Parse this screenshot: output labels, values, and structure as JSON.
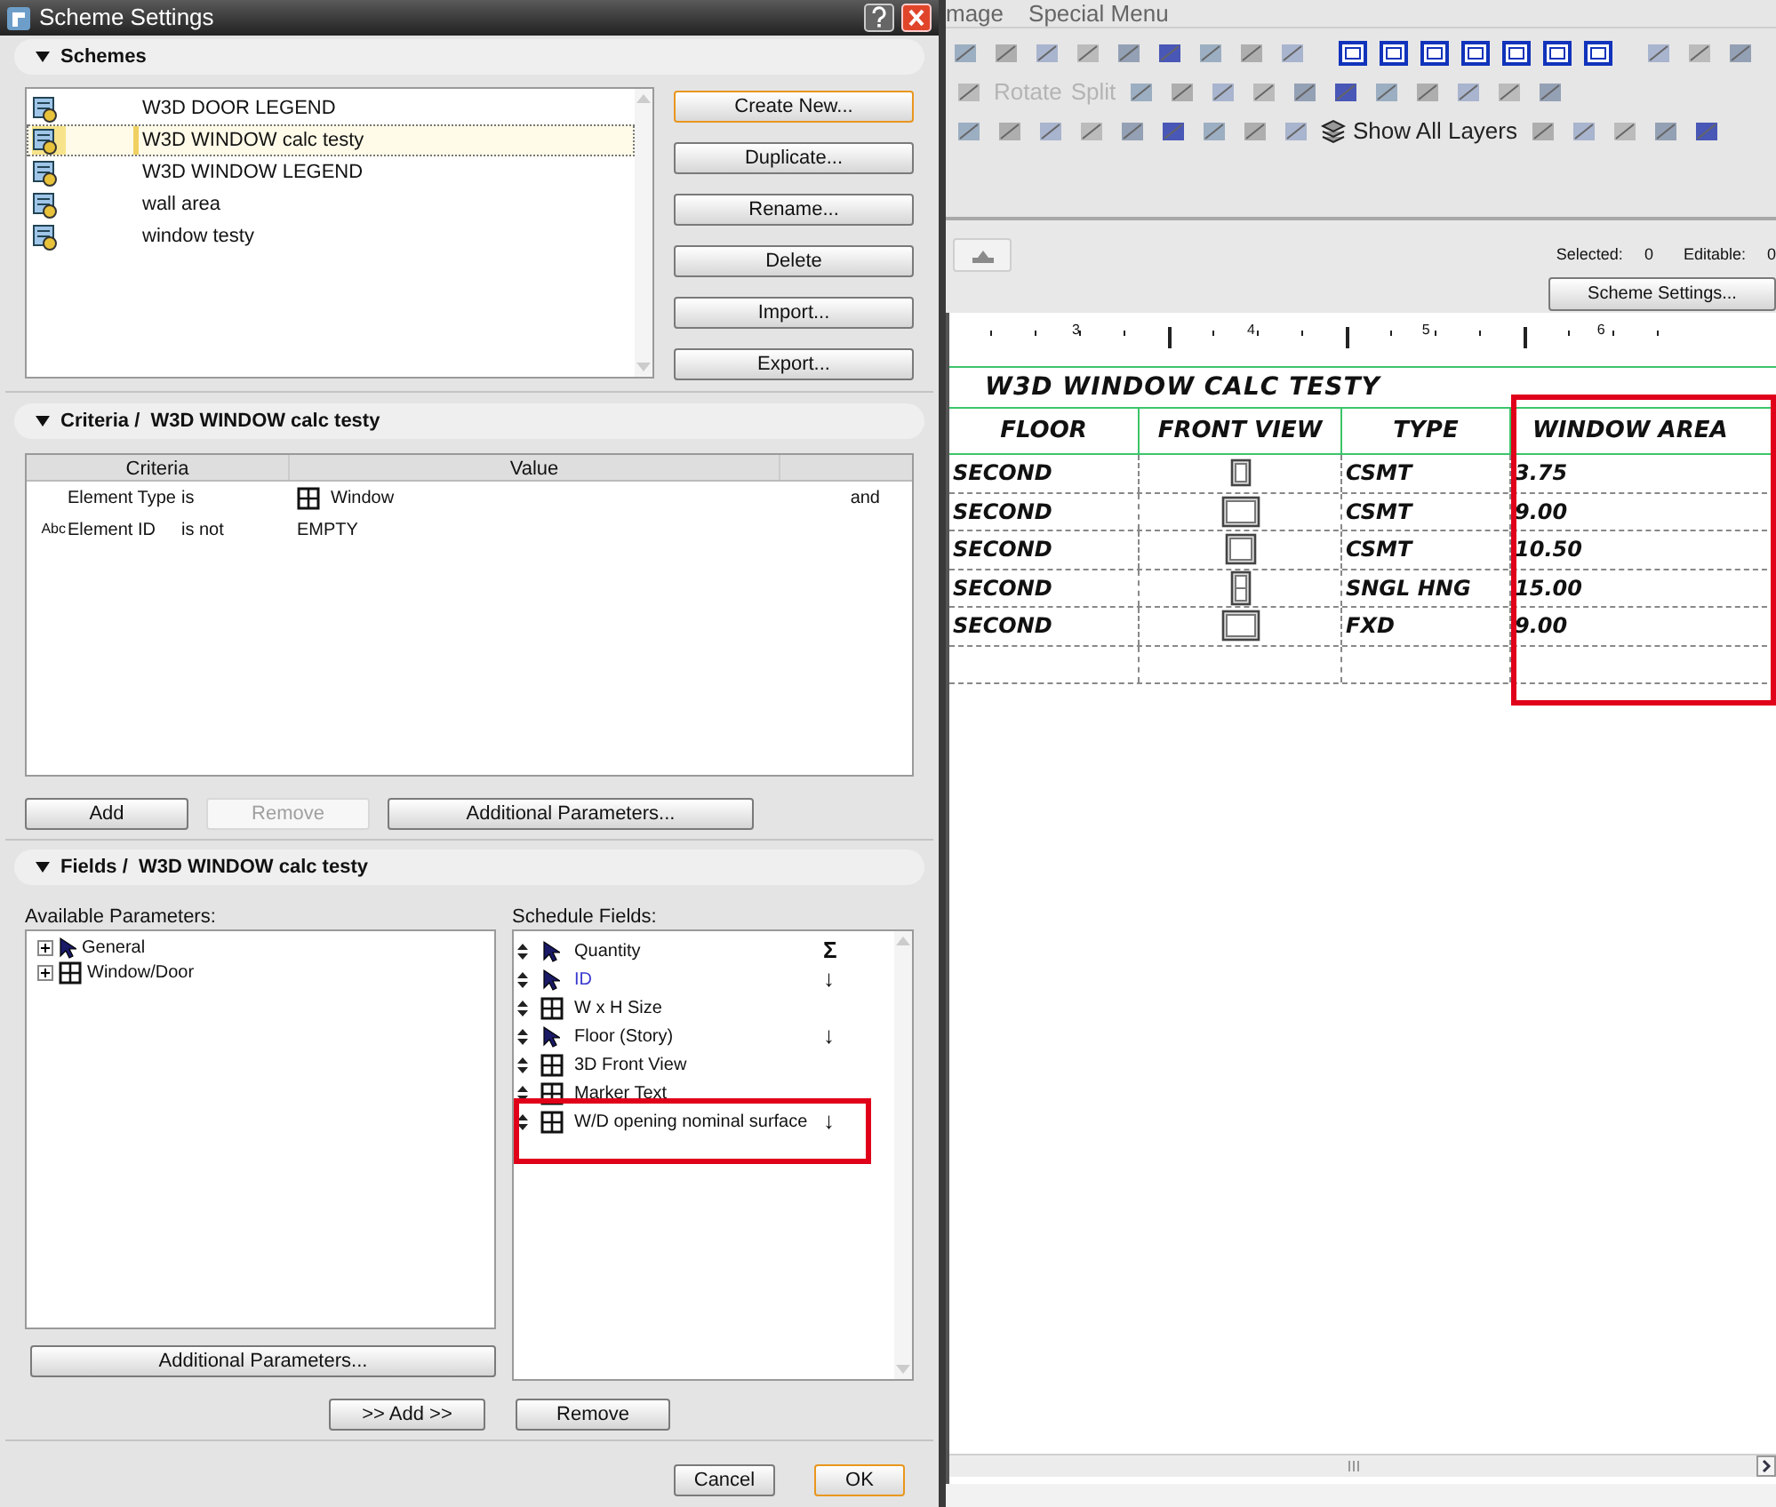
{
  "dialog": {
    "title": "Scheme Settings",
    "schemes": {
      "header": "Schemes",
      "items": [
        {
          "name": "W3D DOOR LEGEND",
          "selected": false
        },
        {
          "name": "W3D WINDOW calc testy",
          "selected": true
        },
        {
          "name": "W3D WINDOW LEGEND",
          "selected": false
        },
        {
          "name": "wall area",
          "selected": false
        },
        {
          "name": "window testy",
          "selected": false
        }
      ],
      "buttons": [
        {
          "label": "Create New...",
          "default": true
        },
        {
          "label": "Duplicate...",
          "default": false
        },
        {
          "label": "Rename...",
          "default": false
        },
        {
          "label": "Delete",
          "default": false
        },
        {
          "label": "Import...",
          "default": false
        },
        {
          "label": "Export...",
          "default": false
        }
      ]
    },
    "criteria": {
      "header": "Criteria /  W3D WINDOW calc testy",
      "columns": [
        "Criteria",
        "Value"
      ],
      "rows": [
        {
          "kind": "type",
          "criterion": "Element Type",
          "operator": "is",
          "value": "Window",
          "conjunction": "and"
        },
        {
          "kind": "text",
          "prefix": "Abc",
          "criterion": "Element ID",
          "operator": "is not",
          "value": "EMPTY"
        }
      ],
      "buttons": [
        {
          "label": "Add",
          "disabled": false
        },
        {
          "label": "Remove",
          "disabled": true
        },
        {
          "label": "Additional Parameters...",
          "disabled": false
        }
      ]
    },
    "fields": {
      "header": "Fields /  W3D WINDOW calc testy",
      "available_label": "Available Parameters:",
      "available": [
        {
          "kind": "pointer",
          "label": "General",
          "expanded": false
        },
        {
          "kind": "window",
          "label": "Window/Door",
          "expanded": false
        }
      ],
      "schedule_label": "Schedule Fields:",
      "schedule": [
        {
          "kind": "pointer",
          "label": "Quantity",
          "marker": "Σ",
          "emphasized": false,
          "highlighted": false
        },
        {
          "kind": "pointer",
          "label": "ID",
          "marker": "↓",
          "emphasized": true,
          "highlighted": false
        },
        {
          "kind": "window",
          "label": "W x H Size",
          "emphasized": false,
          "highlighted": false
        },
        {
          "kind": "pointer",
          "label": "Floor (Story)",
          "marker": "↓",
          "emphasized": false,
          "highlighted": false
        },
        {
          "kind": "window",
          "label": "3D Front View",
          "emphasized": false,
          "highlighted": false
        },
        {
          "kind": "window",
          "label": "Marker Text",
          "emphasized": false,
          "highlighted": false
        },
        {
          "kind": "window",
          "label": "W/D opening nominal surface",
          "marker": "↓",
          "emphasized": false,
          "highlighted": true
        }
      ],
      "additional_button": "Additional Parameters...",
      "add_button": ">> Add >>",
      "remove_button": "Remove"
    },
    "footer_buttons": [
      {
        "label": "Cancel",
        "default": false
      },
      {
        "label": "OK",
        "default": true
      }
    ]
  },
  "app": {
    "menu": [
      "mage",
      "Special Menu"
    ],
    "toolbar_texts": [
      {
        "label": "Rotate",
        "disabled": true
      },
      {
        "label": "Split",
        "disabled": true
      }
    ],
    "layers_button": "Show All Layers",
    "selected_label": "Selected:",
    "selected_count": "0",
    "editable_label": "Editable:",
    "editable_count": "0",
    "scheme_button": "Scheme Settings...",
    "ruler": [
      "3",
      "4",
      "5",
      "6"
    ],
    "schedule": {
      "title": "W3D WINDOW CALC TESTY",
      "columns": [
        {
          "label": "FLOOR",
          "highlighted": false
        },
        {
          "label": "FRONT VIEW",
          "highlighted": false
        },
        {
          "label": "TYPE",
          "highlighted": false
        },
        {
          "label": "WINDOW AREA",
          "highlighted": true
        }
      ],
      "rows": [
        {
          "floor": "SECOND",
          "kind": "narrow",
          "type": "CSMT",
          "area": "3.75"
        },
        {
          "floor": "SECOND",
          "kind": "wide",
          "type": "CSMT",
          "area": "9.00"
        },
        {
          "floor": "SECOND",
          "kind": "medium",
          "type": "CSMT",
          "area": "10.50"
        },
        {
          "floor": "SECOND",
          "kind": "hung",
          "type": "SNGL HNG",
          "area": "15.00"
        },
        {
          "floor": "SECOND",
          "kind": "wide",
          "type": "FXD",
          "area": "9.00"
        }
      ]
    }
  }
}
